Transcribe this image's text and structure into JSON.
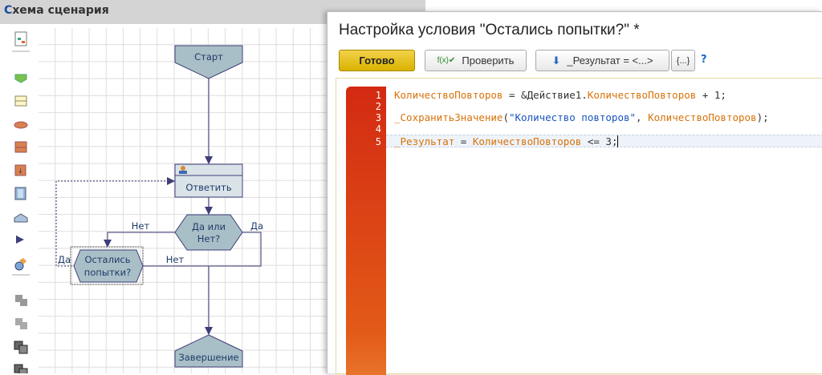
{
  "panel": {
    "title": "Схема сценария"
  },
  "diagram": {
    "start": "Старт",
    "reply": "Ответить",
    "decision": [
      "Да или",
      "Нет?"
    ],
    "condition": [
      "Остались",
      "попытки?"
    ],
    "end": "Завершение",
    "labels": {
      "no1": "Нет",
      "yes1": "Да",
      "yes2": "Да",
      "no2": "Нет"
    }
  },
  "dialog": {
    "title": "Настройка условия \"Остались попытки?\" *",
    "buttons": {
      "done": "Готово",
      "check": "Проверить",
      "result": "_Результат = <...>",
      "braces": "{...}",
      "help": "?"
    },
    "code": {
      "line_numbers": [
        "1",
        "2",
        "3",
        "4",
        "5"
      ],
      "line1": {
        "a": "КоличествоПовторов",
        "b": " = &Действие1.",
        "c": "КоличествоПовторов",
        "d": " + 1;"
      },
      "line3": {
        "a": "_СохранитьЗначение",
        "b": "(",
        "c": "\"Количество повторов\"",
        "d": ", ",
        "e": "КоличествоПовторов",
        "f": ");"
      },
      "line5": {
        "a": "_Результат",
        "b": " = ",
        "c": "КоличествоПовторов",
        "d": " <= 3;"
      }
    }
  }
}
